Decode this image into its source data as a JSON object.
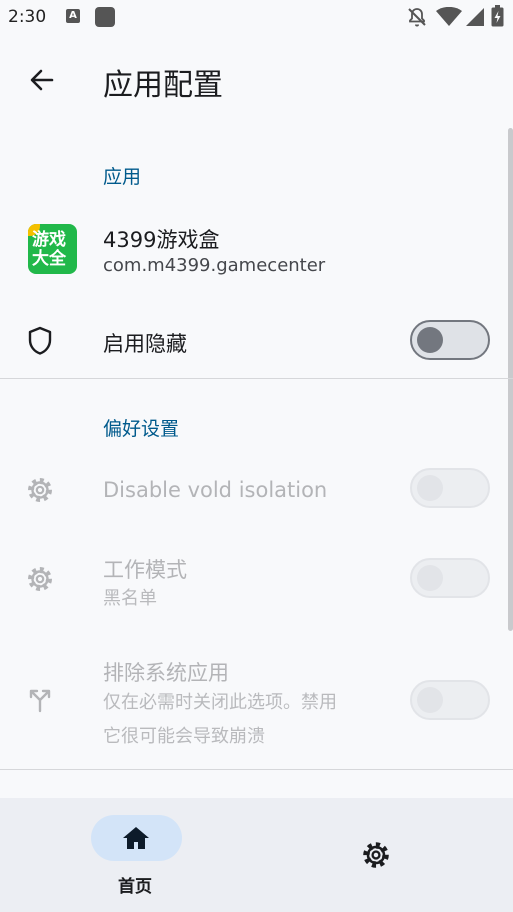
{
  "status_bar": {
    "time": "2:30",
    "a_icon": "A"
  },
  "header": {
    "title": "应用配置"
  },
  "app_section": {
    "heading": "应用",
    "app_name": "4399游戏盒",
    "package": "com.m4399.gamecenter",
    "icon_text_line1": "游戏",
    "icon_text_line2": "大全",
    "hide_label": "启用隐藏"
  },
  "prefs_section": {
    "heading": "偏好设置",
    "vold_label": "Disable vold isolation",
    "mode_label": "工作模式",
    "mode_value": "黑名单",
    "exclude_label": "排除系统应用",
    "exclude_desc_line1": "仅在必需时关闭此选项。禁用",
    "exclude_desc_line2": "它很可能会导致崩溃"
  },
  "bottom_nav": {
    "home_label": "首页"
  },
  "colors": {
    "accent": "#005a8c",
    "app_icon": "#21b84a",
    "nav_pill": "#d3e4f8"
  }
}
